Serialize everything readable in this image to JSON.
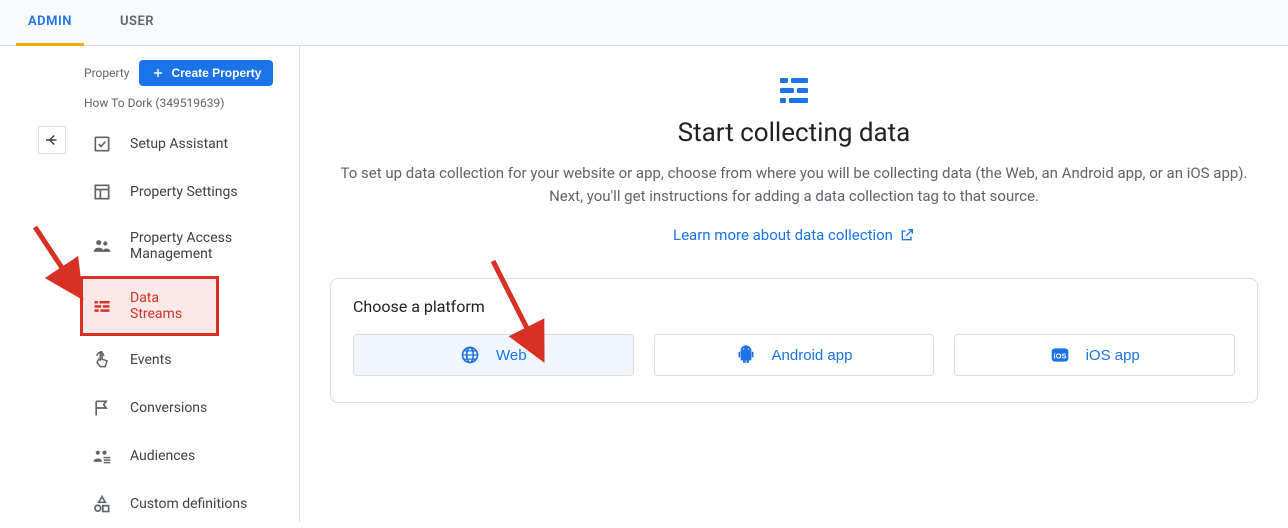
{
  "tabs": {
    "admin": "ADMIN",
    "user": "USER"
  },
  "sidebar": {
    "property_label": "Property",
    "create_label": "Create Property",
    "property_name": "How To Dork (349519639)",
    "items": [
      {
        "label": "Setup Assistant"
      },
      {
        "label": "Property Settings"
      },
      {
        "label": "Property Access Management"
      },
      {
        "label": "Data Streams"
      },
      {
        "label": "Events"
      },
      {
        "label": "Conversions"
      },
      {
        "label": "Audiences"
      },
      {
        "label": "Custom definitions"
      }
    ]
  },
  "hero": {
    "title": "Start collecting data",
    "desc": "To set up data collection for your website or app, choose from where you will be collecting data (the Web, an Android app, or an iOS app). Next, you'll get instructions for adding a data collection tag to that source.",
    "link": "Learn more about data collection"
  },
  "platform": {
    "title": "Choose a platform",
    "options": {
      "web": "Web",
      "android": "Android app",
      "ios": "iOS app"
    }
  }
}
